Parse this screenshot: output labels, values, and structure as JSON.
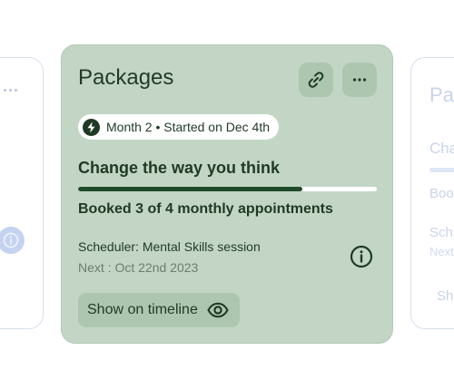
{
  "card": {
    "title": "Packages",
    "chip_text": "Month 2 • Started on Dec 4th",
    "goal_title": "Change the way you think",
    "progress": {
      "booked": 3,
      "total": 4,
      "fraction": 0.75
    },
    "booked_text": "Booked 3 of 4 monthly appointments",
    "scheduler_text": "Scheduler: Mental Skills session",
    "next_text": "Next : Oct 22nd 2023",
    "timeline_button_label": "Show on timeline"
  },
  "right_card_ghost": {
    "title": "Pa",
    "goal": "Cha",
    "booked": "Boo",
    "scheduler": "Sch",
    "next": "Next",
    "button": "Sh"
  },
  "colors": {
    "card_bg": "#c3d6c5",
    "accent": "#1f4a28",
    "button_bg": "#adc6b0",
    "ghost_border": "#d6deee"
  }
}
